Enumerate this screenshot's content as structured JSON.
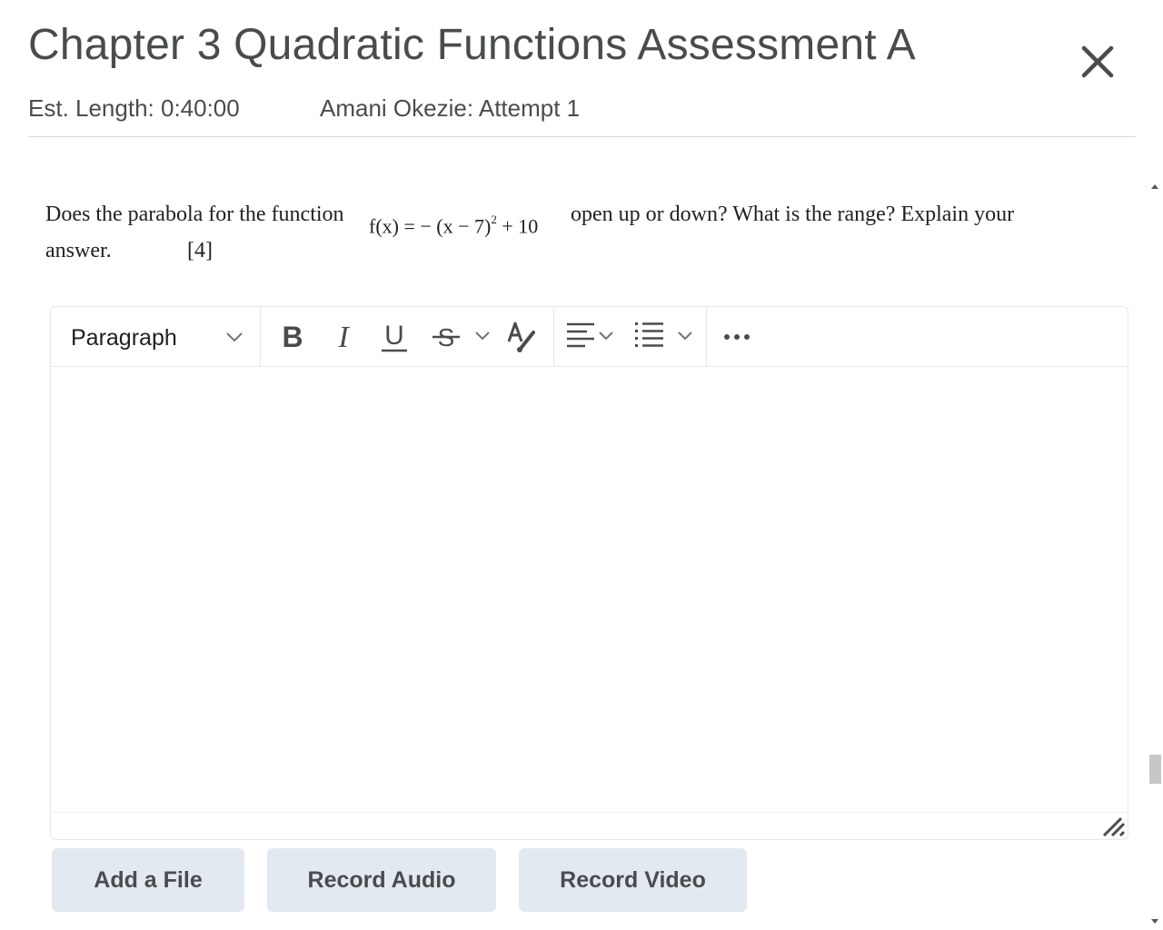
{
  "header": {
    "title": "Chapter 3 Quadratic Functions Assessment A",
    "est_length": "Est. Length: 0:40:00",
    "attempt": "Amani Okezie: Attempt 1"
  },
  "question": {
    "text_before": "Does the parabola for the function",
    "formula_main": "f(x) = − (x − 7)",
    "formula_exponent": "2",
    "formula_tail": " + 10",
    "text_after": "open up or down? What is the range? Explain your",
    "text_line2": "answer.",
    "points": "[4]"
  },
  "editor": {
    "format_value": "Paragraph",
    "buttons": {
      "bold": "Bold",
      "italic": "Italic",
      "underline": "Underline",
      "strikethrough": "Strikethrough",
      "format_more": "More formatting",
      "text_color": "Text color",
      "align": "Alignment",
      "list": "List",
      "more": "More actions"
    },
    "content": ""
  },
  "actions": {
    "add_file": "Add a File",
    "record_audio": "Record Audio",
    "record_video": "Record Video"
  },
  "icons": {
    "close": "close-icon",
    "chevron": "chevron-down-icon",
    "bold": "bold-icon",
    "italic": "italic-icon",
    "underline": "underline-icon",
    "strikethrough": "strikethrough-icon",
    "text_color": "text-color-icon",
    "align": "align-left-icon",
    "list": "bullet-list-icon",
    "more": "ellipsis-icon",
    "resize": "resize-handle-icon"
  },
  "colors": {
    "text": "#494c4e",
    "button_bg": "#e3e9f1",
    "border": "#e3e9f1"
  }
}
